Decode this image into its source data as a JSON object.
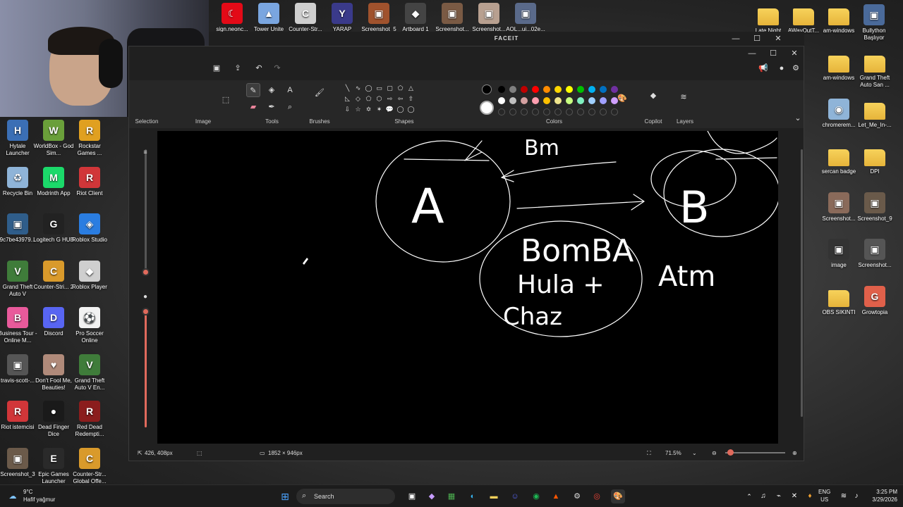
{
  "desktop": {
    "left_icons": [
      {
        "label": "Hytale Launcher",
        "color": "#3b6fb5",
        "glyph": "H"
      },
      {
        "label": "WorldBox - God Sim...",
        "color": "#6a9f3a",
        "glyph": "W"
      },
      {
        "label": "Rockstar Games ...",
        "color": "#e0a020",
        "glyph": "R"
      },
      {
        "label": "Recycle Bin",
        "color": "#8fb4d8",
        "glyph": "♻"
      },
      {
        "label": "Modrinth App",
        "color": "#1bd96a",
        "glyph": "M"
      },
      {
        "label": "Riot Client",
        "color": "#d13639",
        "glyph": "R"
      },
      {
        "label": "9c7be43979...",
        "color": "#2f5d8a",
        "glyph": "▣"
      },
      {
        "label": "Logitech G HUB",
        "color": "#222222",
        "glyph": "G"
      },
      {
        "label": "Roblox Studio",
        "color": "#2a7de1",
        "glyph": "◈"
      },
      {
        "label": "Grand Theft Auto V",
        "color": "#3f7c3a",
        "glyph": "V"
      },
      {
        "label": "Counter-Stri... 2",
        "color": "#d99a2b",
        "glyph": "C"
      },
      {
        "label": "Roblox Player",
        "color": "#cfcfcf",
        "glyph": "◆"
      },
      {
        "label": "Business Tour - Online M...",
        "color": "#e85a9b",
        "glyph": "B"
      },
      {
        "label": "Discord",
        "color": "#5865f2",
        "glyph": "D"
      },
      {
        "label": "Pro Soccer Online",
        "color": "#f2f2f2",
        "glyph": "⚽"
      },
      {
        "label": "travis-scott-...",
        "color": "#555555",
        "glyph": "▣"
      },
      {
        "label": "Don't Fool Me, Beauties!",
        "color": "#b08a7a",
        "glyph": "♥"
      },
      {
        "label": "Grand Theft Auto V En...",
        "color": "#3f7c3a",
        "glyph": "V"
      },
      {
        "label": "Riot istemcisi",
        "color": "#d13639",
        "glyph": "R"
      },
      {
        "label": "Dead Finger Dice",
        "color": "#1a1a1a",
        "glyph": "●"
      },
      {
        "label": "Red Dead Redempti...",
        "color": "#8b1d1d",
        "glyph": "R"
      },
      {
        "label": "Screenshot_3",
        "color": "#6b5a4a",
        "glyph": "▣"
      },
      {
        "label": "Epic Games Launcher",
        "color": "#2a2a2a",
        "glyph": "E"
      },
      {
        "label": "Counter-Str... Global Offe...",
        "color": "#d99a2b",
        "glyph": "C"
      }
    ],
    "top_icons": [
      {
        "label": "sign.neonc...",
        "color": "#e30a17",
        "glyph": "☾"
      },
      {
        "label": "Tower Unite",
        "color": "#7aa6e0",
        "glyph": "▲"
      },
      {
        "label": "Counter-Str...",
        "color": "#cfcfcf",
        "glyph": "C"
      },
      {
        "label": "YARAP",
        "color": "#3a3a8a",
        "glyph": "Y"
      },
      {
        "label": "Screenshot_5",
        "color": "#a0522d",
        "glyph": "▣"
      },
      {
        "label": "Artboard 1",
        "color": "#444444",
        "glyph": "◆"
      },
      {
        "label": "Screenshot...",
        "color": "#7a5a44",
        "glyph": "▣"
      },
      {
        "label": "Screenshot...",
        "color": "#b8a090",
        "glyph": "▣"
      },
      {
        "label": "AOL...ui...02e...",
        "color": "#5a6a8a",
        "glyph": "▣"
      }
    ],
    "right_icons": [
      {
        "label": "Late Night Drinking",
        "color": "#f7d25b",
        "glyph": "",
        "folder": true
      },
      {
        "label": "AWayOutT...",
        "color": "#f7d25b",
        "glyph": "",
        "folder": true
      },
      {
        "label": "am-windows",
        "color": "#f7d25b",
        "glyph": "",
        "folder": true
      },
      {
        "label": "Bullython Başlıyor",
        "color": "#4a6a9a",
        "glyph": "▣"
      },
      {
        "label": "am-windows",
        "color": "#f7d25b",
        "glyph": "",
        "folder": true
      },
      {
        "label": "Grand Theft Auto San ...",
        "color": "#f7d25b",
        "glyph": "",
        "folder": true
      },
      {
        "label": "chromerem...",
        "color": "#8fb4d8",
        "glyph": "◉"
      },
      {
        "label": "Let_Me_In-...",
        "color": "#f7d25b",
        "glyph": "",
        "folder": true
      },
      {
        "label": "sercan badge",
        "color": "#f7d25b",
        "glyph": "",
        "folder": true
      },
      {
        "label": "DPI",
        "color": "#f7d25b",
        "glyph": "",
        "folder": true
      },
      {
        "label": "Screenshot...",
        "color": "#8a6a5a",
        "glyph": "▣"
      },
      {
        "label": "Screenshot_9",
        "color": "#6a5a4a",
        "glyph": "▣"
      },
      {
        "label": "image",
        "color": "#333333",
        "glyph": "▣"
      },
      {
        "label": "Screenshot...",
        "color": "#555555",
        "glyph": "▣"
      },
      {
        "label": "OBS SIKINTI",
        "color": "#f7d25b",
        "glyph": "",
        "folder": true
      },
      {
        "label": "Growtopia",
        "color": "#e0604a",
        "glyph": "G"
      }
    ]
  },
  "faceit": {
    "title": "FACEIT"
  },
  "paint": {
    "ribbon": {
      "selection": "Selection",
      "image": "Image",
      "tools": "Tools",
      "brushes": "Brushes",
      "shapes": "Shapes",
      "colors": "Colors",
      "copilot": "Copilot",
      "layers": "Layers"
    },
    "shapes": [
      "╲",
      "∿",
      "◯",
      "▭",
      "▢",
      "⬠",
      "△",
      "◺",
      "◇",
      "⬠",
      "⬡",
      "⇨",
      "⇦",
      "⇧",
      "⇩",
      "☆",
      "✡",
      "✶",
      "💬",
      "◯",
      "◯"
    ],
    "palette_row1": [
      "#000000",
      "#7f7f7f",
      "#c00000",
      "#ff0000",
      "#ff8c00",
      "#ffd700",
      "#ffff00",
      "#00c000",
      "#00b0f0",
      "#0070c0",
      "#7030a0"
    ],
    "palette_row2": [
      "#ffffff",
      "#c0c0c0",
      "#d4a0a0",
      "#ff9fb0",
      "#ffc000",
      "#f0e68c",
      "#c8ff80",
      "#80f0c0",
      "#a0d0ff",
      "#a0a0ff",
      "#d0a0ff"
    ],
    "primary_color": "#000000",
    "secondary_color": "#ffffff",
    "canvas_text": {
      "bm": "Bm",
      "a": "A",
      "b": "B",
      "bomba": "BomBA",
      "hula": "Hula +",
      "chaz": "Chaz",
      "atm": "Atm"
    },
    "status": {
      "cursor_pos": "426, 408px",
      "canvas_size": "1852 × 946px",
      "zoom": "71.5%"
    }
  },
  "taskbar": {
    "weather_temp": "9°C",
    "weather_desc": "Hafif yağmur",
    "search_placeholder": "Search",
    "lang_top": "ENG",
    "lang_bottom": "US",
    "time": "3:25 PM",
    "date": "3/29/2026"
  }
}
